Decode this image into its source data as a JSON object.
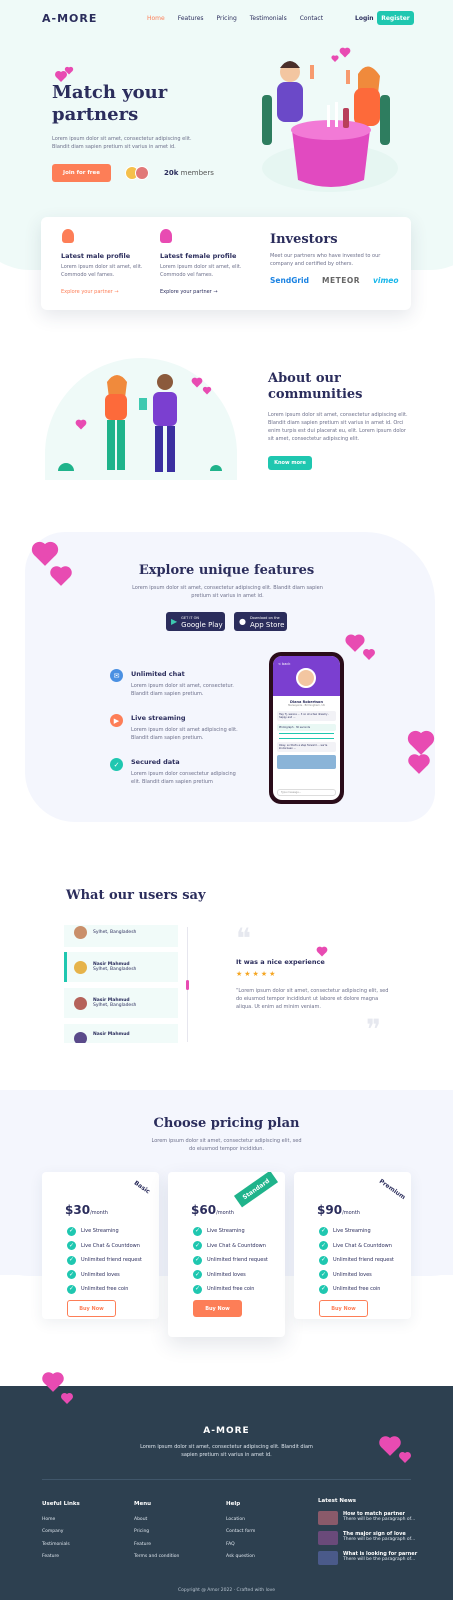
{
  "brand": "A-MORE",
  "nav": {
    "items": [
      "Home",
      "Features",
      "Pricing",
      "Testimonials",
      "Contact"
    ],
    "login": "Login",
    "register": "Register"
  },
  "hero": {
    "title": "Match your partners",
    "subtitle": "Lorem ipsum dolor sit amet, consectetur adipiscing elit. Blandit diam sapien pretium sit varius in amet id.",
    "cta": "Join for free",
    "members_count": "20k",
    "members_label": "members"
  },
  "profiles": {
    "male_title": "Latest male profile",
    "male_text": "Lorem ipsum dolor sit amet, elit. Commodo vel fames.",
    "male_link": "Explore your partner",
    "female_title": "Latest female profile",
    "female_text": "Lorem ipsum dolor sit amet, elit. Commodo vel fames.",
    "female_link": "Explore your partner"
  },
  "investors": {
    "title": "Investors",
    "text": "Meet our partners who have invested to our company and certified by others.",
    "logos": [
      "SendGrid",
      "METEOR",
      "vimeo"
    ]
  },
  "about": {
    "title": "About our communities",
    "text": "Lorem ipsum dolor sit amet, consectetur adipiscing elit. Blandit diam sapien pretium sit varius in amet id. Orci enim turpis est dui placerat eu, elit. Lorem ipsum dolor sit amet, consectetur adipiscing elit.",
    "cta": "Know more"
  },
  "features": {
    "title": "Explore unique features",
    "subtitle": "Lorem ipsum dolor sit amet, consectetur adipiscing elit. Blandit diam sapien pretium sit varius in amet id.",
    "google_small": "GET IT ON",
    "google_big": "Google Play",
    "apple_small": "Download on the",
    "apple_big": "App Store",
    "items": [
      {
        "title": "Unlimited chat",
        "text": "Lorem ipsum dolor sit amet, consectetur. Blandit diam sapien pretium."
      },
      {
        "title": "Live streaming",
        "text": "Lorem ipsum dolor sit amet adipiscing elit. Blandit diam sapien pretium."
      },
      {
        "title": "Secured data",
        "text": "Lorem ipsum dolor consectetur adipiscing elit. Blandit diam sapien pretium"
      }
    ],
    "phone": {
      "back": "< back",
      "name": "Diana Robertson",
      "location": "Merseyside · Birmingham, UK",
      "msg1": "Hey Tj, wanna ... 3 on at a few dreamy - happy and ...",
      "msg2": "Photograph · 30 seconds",
      "msg3": "Okay, so that's a step forward ... we're kinda been ...",
      "input": "Type message..."
    }
  },
  "testimonials": {
    "title": "What our users say",
    "users": [
      {
        "name": "",
        "loc": "Sylhet, Bangladesh"
      },
      {
        "name": "Nasir Mahmud",
        "loc": "Sylhet, Bangladesh"
      },
      {
        "name": "Nasir Mahmud",
        "loc": "Sylhet, Bangladesh"
      },
      {
        "name": "Nasir Mahmud",
        "loc": ""
      }
    ],
    "quote_title": "It was a nice experience",
    "stars": "★★★★★",
    "quote": "“Lorem ipsum dolor sit amet, consectetur adipiscing elit, sed do eiusmod tempor incididunt ut labore et dolore magna aliqua. Ut enim ad minim veniam."
  },
  "pricing": {
    "title": "Choose pricing plan",
    "subtitle": "Lorem ipsum dolor sit amet, consectetur adipiscing elit, sed do eiusmod tempor incididun.",
    "per": "/month",
    "buy": "Buy Now",
    "plans": [
      {
        "tag": "Basic",
        "price": "$30"
      },
      {
        "tag": "Standard",
        "price": "$60"
      },
      {
        "tag": "Premium",
        "price": "$90"
      }
    ],
    "features": [
      "Live Streaming",
      "Live Chat & Countdown",
      "Unlimited friend request",
      "Unlimited loves",
      "Unlimited free coin"
    ]
  },
  "footer": {
    "brand": "A-MORE",
    "text": "Lorem ipsum dolor sit amet, consectetur adipiscing elit. Blandit diam sapien pretium sit varius in amet id.",
    "cols": [
      {
        "title": "Useful Links",
        "items": [
          "Home",
          "Company",
          "Testimonials",
          "Feature"
        ]
      },
      {
        "title": "Menu",
        "items": [
          "About",
          "Pricing",
          "Feature",
          "Terms and condition"
        ]
      },
      {
        "title": "Help",
        "items": [
          "Location",
          "Contact form",
          "FAQ",
          "Ask question"
        ]
      }
    ],
    "news_title": "Latest News",
    "news": [
      {
        "title": "How to match partner",
        "text": "There will be the paragraph of..."
      },
      {
        "title": "The major sign of love",
        "text": "There will be the paragraph of..."
      },
      {
        "title": "What is looking for parner",
        "text": "There will be the paragraph of..."
      }
    ],
    "copyright": "Copyright @ Amor 2022 · Crafted with love"
  }
}
